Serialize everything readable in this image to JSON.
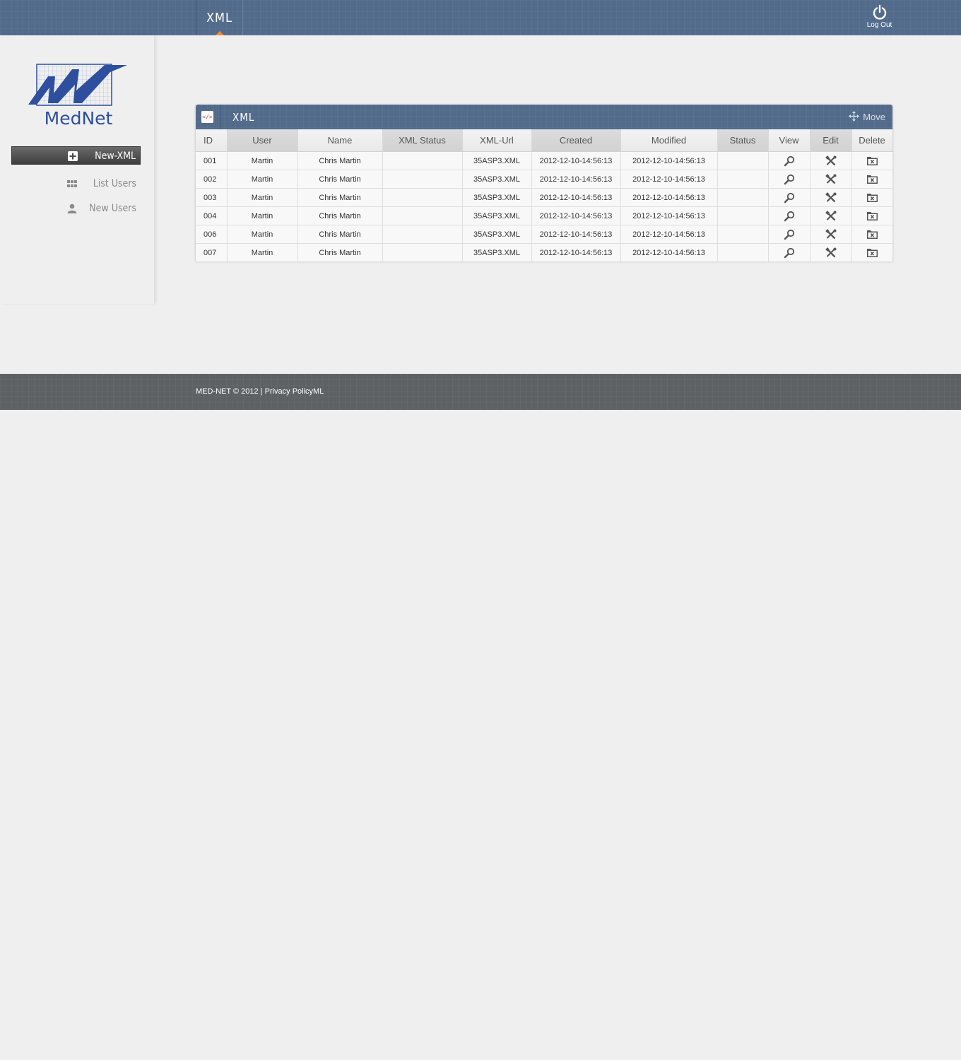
{
  "header": {
    "tab_label": "XML",
    "logout_label": "Log Out",
    "accent_color": "#f08a2c",
    "bar_color": "#536b8b"
  },
  "brand": {
    "logo_text": "MedNet",
    "logo_color": "#2e4f9e"
  },
  "sidebar": {
    "items": [
      {
        "label": "New-XML",
        "icon": "plus-icon",
        "active": true
      },
      {
        "label": "List Users",
        "icon": "grid-icon",
        "active": false
      },
      {
        "label": "New Users",
        "icon": "user-icon",
        "active": false
      }
    ]
  },
  "panel": {
    "title": "XML",
    "icon": "xml-file-icon",
    "icon_text": "</>",
    "move_label": "Move"
  },
  "table": {
    "columns": [
      "ID",
      "User",
      "Name",
      "XML Status",
      "XML-Url",
      "Created",
      "Modified",
      "Status",
      "View",
      "Edit",
      "Delete"
    ],
    "rows": [
      {
        "id": "001",
        "user": "Martin",
        "name": "Chris Martin",
        "xml_status": "",
        "xml_url": "35ASP3.XML",
        "created": "2012-12-10-14:56:13",
        "modified": "2012-12-10-14:56:13",
        "status": ""
      },
      {
        "id": "002",
        "user": "Martin",
        "name": "Chris Martin",
        "xml_status": "",
        "xml_url": "35ASP3.XML",
        "created": "2012-12-10-14:56:13",
        "modified": "2012-12-10-14:56:13",
        "status": ""
      },
      {
        "id": "003",
        "user": "Martin",
        "name": "Chris Martin",
        "xml_status": "",
        "xml_url": "35ASP3.XML",
        "created": "2012-12-10-14:56:13",
        "modified": "2012-12-10-14:56:13",
        "status": ""
      },
      {
        "id": "004",
        "user": "Martin",
        "name": "Chris Martin",
        "xml_status": "",
        "xml_url": "35ASP3.XML",
        "created": "2012-12-10-14:56:13",
        "modified": "2012-12-10-14:56:13",
        "status": ""
      },
      {
        "id": "006",
        "user": "Martin",
        "name": "Chris Martin",
        "xml_status": "",
        "xml_url": "35ASP3.XML",
        "created": "2012-12-10-14:56:13",
        "modified": "2012-12-10-14:56:13",
        "status": ""
      },
      {
        "id": "007",
        "user": "Martin",
        "name": "Chris Martin",
        "xml_status": "",
        "xml_url": "35ASP3.XML",
        "created": "2012-12-10-14:56:13",
        "modified": "2012-12-10-14:56:13",
        "status": ""
      }
    ],
    "action_icons": {
      "view": "magnifier-icon",
      "edit": "tools-icon",
      "delete": "delete-folder-icon"
    }
  },
  "footer": {
    "copyright": "MED-NET  © 2012 |",
    "privacy_link": "Privacy PolicyML"
  }
}
